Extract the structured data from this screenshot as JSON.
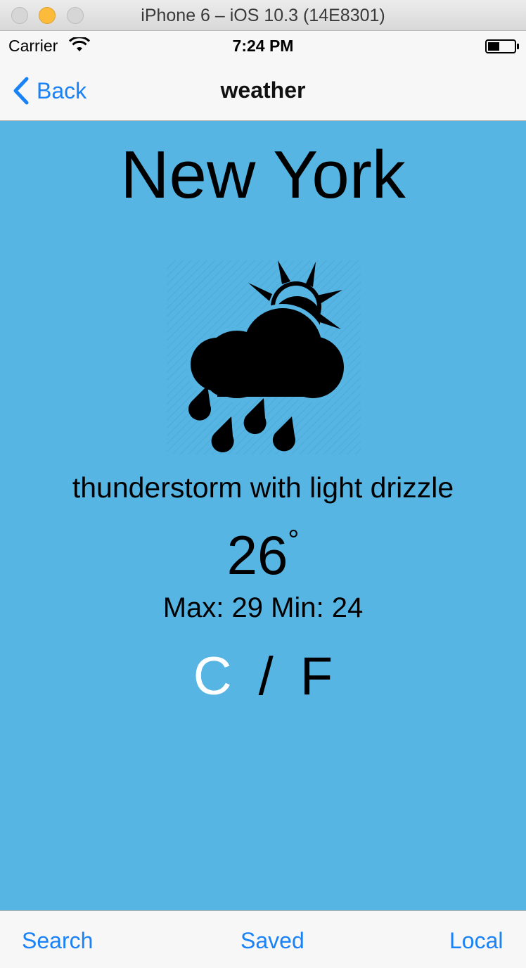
{
  "window": {
    "title": "iPhone 6 – iOS 10.3 (14E8301)"
  },
  "status_bar": {
    "carrier": "Carrier",
    "time": "7:24 PM",
    "wifi_icon": "wifi-icon",
    "battery_icon": "battery-icon"
  },
  "nav": {
    "back_label": "Back",
    "title": "weather"
  },
  "weather": {
    "city": "New York",
    "icon": "thunderstorm-drizzle-icon",
    "description": "thunderstorm with light drizzle",
    "temperature": "26",
    "degree_symbol": "°",
    "minmax": "Max: 29 Min: 24",
    "unit_c": "C",
    "unit_separator": "/",
    "unit_f": "F"
  },
  "tabs": [
    {
      "label": "Search"
    },
    {
      "label": "Saved"
    },
    {
      "label": "Local"
    }
  ],
  "colors": {
    "background": "#56b5e3",
    "accent": "#1a82f7",
    "selected_unit": "#ffffff"
  }
}
